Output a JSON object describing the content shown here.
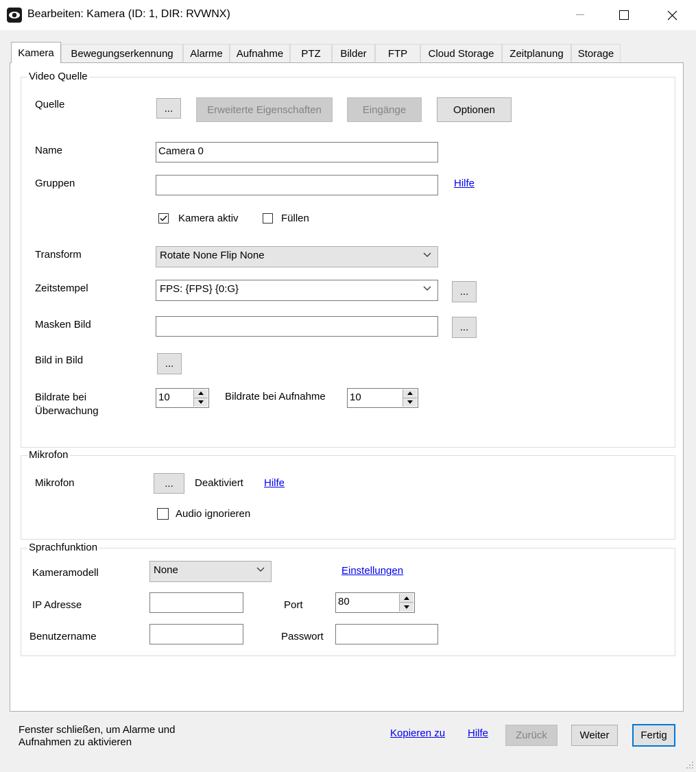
{
  "window": {
    "title": "Bearbeiten: Kamera (ID: 1, DIR: RVWNX)",
    "minimize_glyph": "—",
    "maximize_glyph": "☐",
    "close_glyph": "✕"
  },
  "tabs": [
    {
      "label": "Kamera"
    },
    {
      "label": "Bewegungserkennung"
    },
    {
      "label": "Alarme"
    },
    {
      "label": "Aufnahme"
    },
    {
      "label": "PTZ"
    },
    {
      "label": "Bilder"
    },
    {
      "label": "FTP"
    },
    {
      "label": "Cloud Storage"
    },
    {
      "label": "Zeitplanung"
    },
    {
      "label": "Storage"
    }
  ],
  "video": {
    "legend": "Video Quelle",
    "quelle_label": "Quelle",
    "dots": "...",
    "erweitert_label": "Erweiterte Eigenschaften",
    "eingaenge_label": "Eingänge",
    "optionen_label": "Optionen",
    "name_label": "Name",
    "name_value": "Camera 0",
    "gruppen_label": "Gruppen",
    "gruppen_value": "",
    "hilfe": "Hilfe",
    "kamera_aktiv_label": "Kamera aktiv",
    "kamera_aktiv_checked": true,
    "fuellen_label": "Füllen",
    "fuellen_checked": false,
    "transform_label": "Transform",
    "transform_value": "Rotate None Flip None",
    "zeitstempel_label": "Zeitstempel",
    "zeitstempel_value": "FPS: {FPS} {0:G}",
    "masken_label": "Masken Bild",
    "masken_value": "",
    "bildinbild_label": "Bild in Bild",
    "bildrate_ueberwachung_label_1": "Bildrate bei",
    "bildrate_ueberwachung_label_2": "Überwachung",
    "bildrate_ueberwachung_value": "10",
    "bildrate_aufnahme_label": "Bildrate bei Aufnahme",
    "bildrate_aufnahme_value": "10"
  },
  "mikrofon": {
    "legend": "Mikrofon",
    "label": "Mikrofon",
    "dots": "...",
    "status": "Deaktiviert",
    "hilfe": "Hilfe",
    "audio_ignorieren_label": "Audio ignorieren",
    "audio_ignorieren_checked": false
  },
  "sprach": {
    "legend": "Sprachfunktion",
    "kameramodell_label": "Kameramodell",
    "kameramodell_value": "None",
    "einstellungen_link": "Einstellungen",
    "ip_label": "IP Adresse",
    "ip_value": "",
    "port_label": "Port",
    "port_value": "80",
    "benutzer_label": "Benutzername",
    "benutzer_value": "",
    "passwort_label": "Passwort",
    "passwort_value": ""
  },
  "footer": {
    "note_line1": "Fenster schließen, um Alarme und",
    "note_line2": "Aufnahmen zu aktivieren",
    "kopieren_link": "Kopieren zu",
    "hilfe_link": "Hilfe",
    "zurueck_label": "Zurück",
    "weiter_label": "Weiter",
    "fertig_label": "Fertig"
  }
}
